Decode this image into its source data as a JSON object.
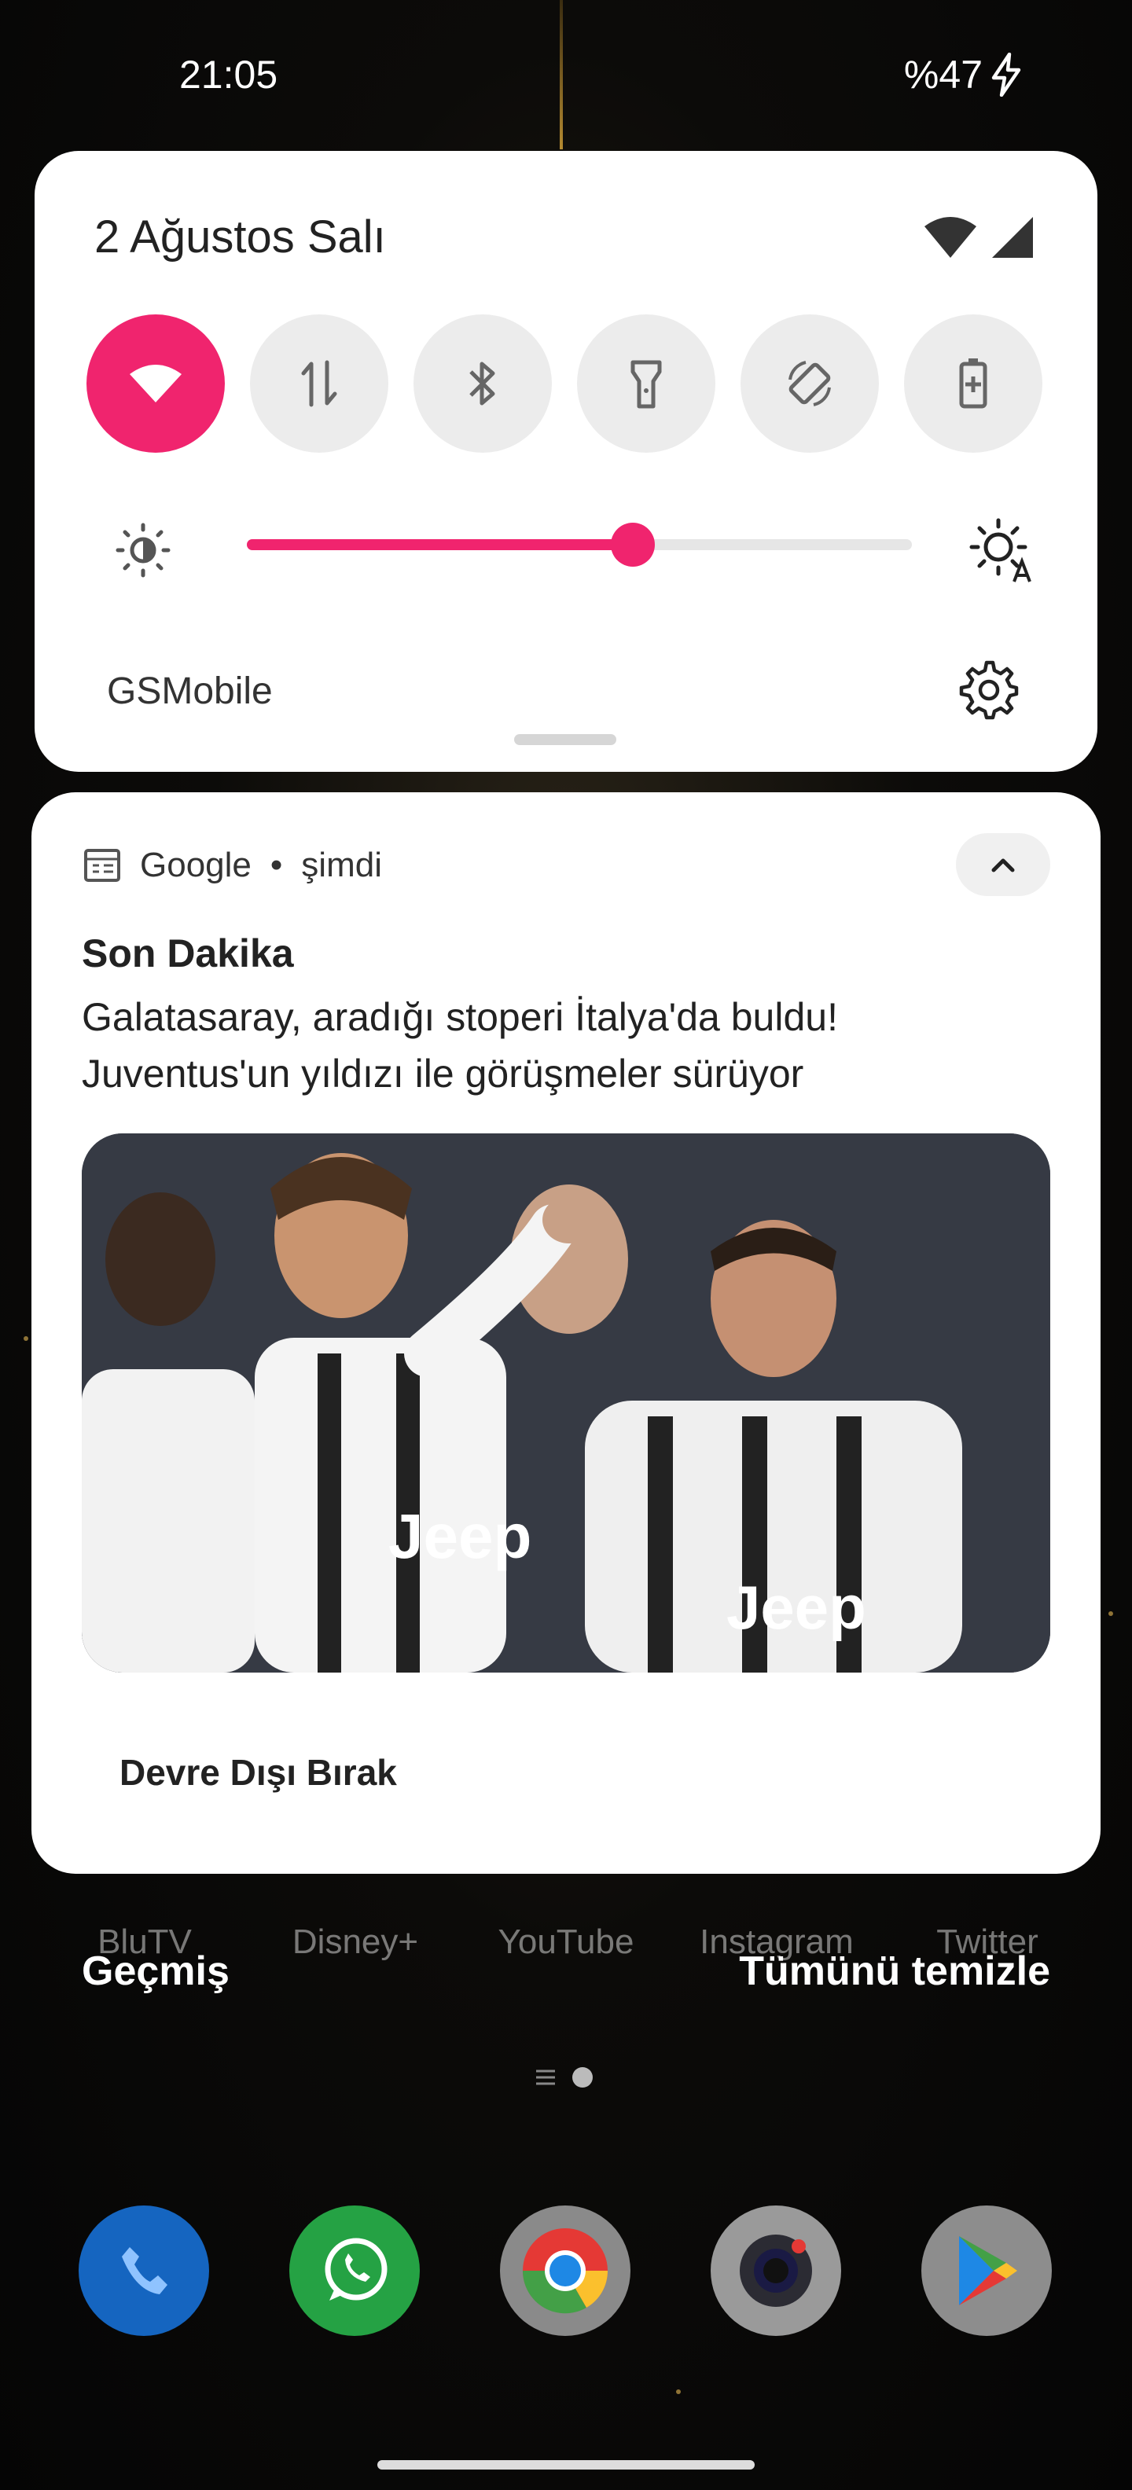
{
  "status_bar": {
    "time": "21:05",
    "battery": "%47"
  },
  "quick_settings": {
    "date": "2 Ağustos Salı",
    "operator": "GSMobile",
    "brightness_level": 0.58,
    "tiles": [
      {
        "name": "wifi",
        "active": true
      },
      {
        "name": "mobile-data",
        "active": false
      },
      {
        "name": "bluetooth",
        "active": false
      },
      {
        "name": "flashlight",
        "active": false
      },
      {
        "name": "auto-rotate",
        "active": false
      },
      {
        "name": "battery-saver",
        "active": false
      }
    ],
    "accent": "#f0246e"
  },
  "notification": {
    "app": "Google",
    "time": "şimdi",
    "title": "Son Dakika",
    "body": "Galatasaray, aradığı stoperi İtalya'da buldu! Juventus'un yıldızı ile görüşmeler sürüyor",
    "image_jersey_text": [
      "Jeep",
      "Jeep"
    ],
    "action": "Devre Dışı Bırak"
  },
  "home": {
    "app_labels": [
      "BluTV",
      "Disney+",
      "YouTube",
      "Instagram",
      "Twitter"
    ],
    "history": "Geçmiş",
    "clear_all": "Tümünü temizle",
    "dock": [
      "phone-icon",
      "whatsapp-icon",
      "chrome-icon",
      "camera-icon",
      "play-store-icon"
    ]
  }
}
